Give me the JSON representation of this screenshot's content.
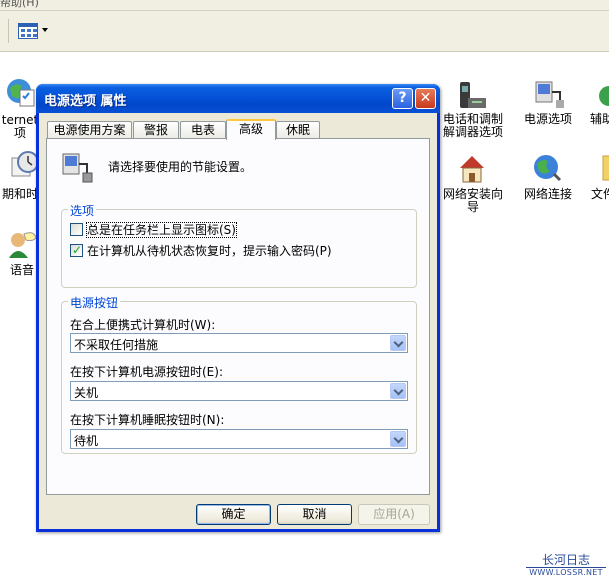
{
  "menu_fragment": "帮助(H)",
  "background_items": [
    {
      "id": "internet",
      "lines": [
        "ternet",
        "项"
      ]
    },
    {
      "id": "datetime",
      "lines": [
        "期和时"
      ]
    },
    {
      "id": "speech",
      "lines": [
        "语音"
      ]
    },
    {
      "id": "phone-modem",
      "lines": [
        "电话和调制",
        "解调器选项"
      ]
    },
    {
      "id": "power-options",
      "lines": [
        "电源选项"
      ]
    },
    {
      "id": "accessibility",
      "lines": [
        "辅助"
      ]
    },
    {
      "id": "network-setup",
      "lines": [
        "网络安装向",
        "导"
      ]
    },
    {
      "id": "network-connections",
      "lines": [
        "网络连接"
      ]
    },
    {
      "id": "folder",
      "lines": [
        "文件"
      ]
    }
  ],
  "dialog": {
    "title": "电源选项 属性",
    "help_glyph": "?",
    "close_glyph": "✕",
    "tabs": [
      "电源使用方案",
      "警报",
      "电表",
      "高级",
      "休眠"
    ],
    "active_tab": "高级",
    "header_text": "请选择要使用的节能设置。",
    "options_group": {
      "title": "选项",
      "checkboxes": [
        {
          "label": "总是在任务栏上显示图标(S)",
          "checked": false
        },
        {
          "label": "在计算机从待机状态恢复时，提示输入密码(P)",
          "checked": true
        }
      ]
    },
    "power_buttons_group": {
      "title": "电源按钮",
      "combos": [
        {
          "label": "在合上便携式计算机时(W):",
          "value": "不采取任何措施"
        },
        {
          "label": "在按下计算机电源按钮时(E):",
          "value": "关机"
        },
        {
          "label": "在按下计算机睡眠按钮时(N):",
          "value": "待机"
        }
      ]
    },
    "buttons": {
      "ok": "确定",
      "cancel": "取消",
      "apply": "应用(A)"
    }
  },
  "watermark": {
    "title": "长河日志",
    "url": "WWW.LOSSR.NET"
  },
  "colors": {
    "title_blue": "#0a5fe0",
    "group_title": "#0046d5",
    "dialog_face": "#ece9d8",
    "check_green": "#21a121"
  }
}
